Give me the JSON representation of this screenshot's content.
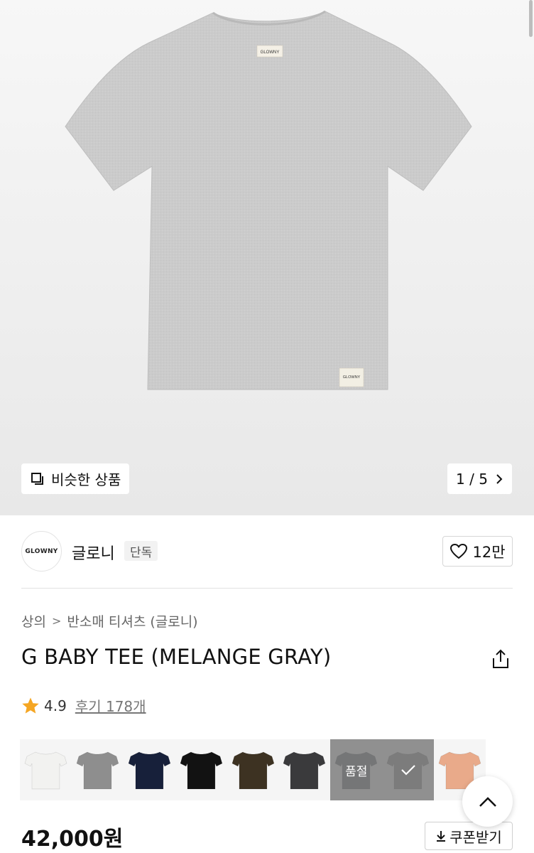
{
  "gallery": {
    "similar_label": "비슷한 상품",
    "current": "1",
    "separator": "/",
    "total": "5",
    "tag_text": "GLOWNY"
  },
  "brand": {
    "logo_text": "GLOWNY",
    "name": "글로니",
    "badge": "단독",
    "like_count": "12만"
  },
  "breadcrumb": {
    "items": [
      "상의",
      "반소매 티셔츠 (글로니)"
    ],
    "separator": ">"
  },
  "product": {
    "title": "G BABY TEE (MELANGE GRAY)",
    "rating": "4.9",
    "review_label": "후기 178개",
    "price": "42,000원",
    "coupon_label": "쿠폰받기"
  },
  "swatches": [
    {
      "color": "#f2f2f0",
      "status": ""
    },
    {
      "color": "#8e8e8e",
      "status": ""
    },
    {
      "color": "#17203a",
      "status": ""
    },
    {
      "color": "#121212",
      "status": ""
    },
    {
      "color": "#3d3222",
      "status": ""
    },
    {
      "color": "#3a3a3c",
      "status": ""
    },
    {
      "color": "#8c8f95",
      "status": "품절"
    },
    {
      "color": "#a7a7a7",
      "status": "selected"
    },
    {
      "color": "#e9aa8a",
      "status": ""
    }
  ],
  "colors": {
    "star": "#f5a623",
    "tee": "#c9c9c9"
  }
}
